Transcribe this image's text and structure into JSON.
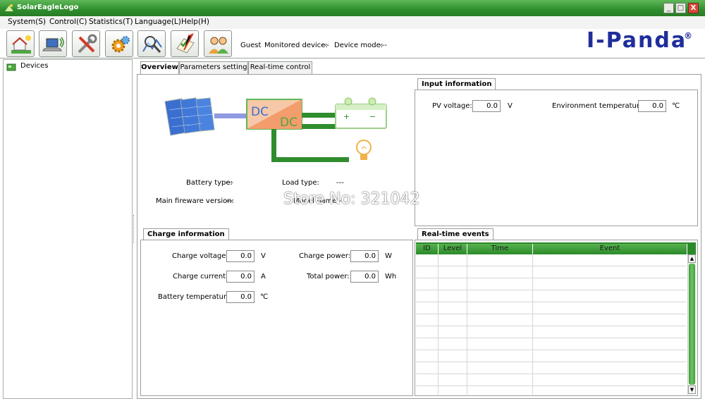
{
  "window": {
    "title": "SolarEagleLogo",
    "minimize": "_",
    "maximize": "□",
    "close": "X"
  },
  "menu": [
    {
      "label": "System(S)"
    },
    {
      "label": "Control(C)"
    },
    {
      "label": "Statistics(T)"
    },
    {
      "label": "Language(L)"
    },
    {
      "label": "Help(H)"
    }
  ],
  "toolbar": {
    "buttons": [
      {
        "icon": "house-solar-icon"
      },
      {
        "icon": "laptop-connection-icon"
      },
      {
        "icon": "tools-icon"
      },
      {
        "icon": "gear-settings-icon"
      },
      {
        "icon": "search-icon"
      },
      {
        "icon": "checklist-edit-icon"
      },
      {
        "icon": "users-icon"
      }
    ],
    "user": "Guest",
    "monitored_device_label": "Monitored device:",
    "monitored_device_value": "---",
    "device_mode_label": "Device mode:",
    "device_mode_value": "---",
    "brand": "I-Panda",
    "brand_mark": "®"
  },
  "tree": {
    "root": "Devices"
  },
  "tabs": [
    {
      "label": "Overview",
      "active": true
    },
    {
      "label": "Parameters setting",
      "active": false
    },
    {
      "label": "Real-time control",
      "active": false
    }
  ],
  "overview": {
    "diagram": {
      "dc_in": "DC",
      "dc_out": "DC",
      "plus": "+",
      "minus": "−"
    },
    "battery_type_label": "Battery type:",
    "battery_type_value": "---",
    "load_type_label": "Load type:",
    "load_type_value": "---",
    "firmware_label": "Main fireware version:",
    "firmware_value": "---",
    "model_label": "Model name",
    "model_value": "---"
  },
  "input_information": {
    "title": "Input information",
    "pv_voltage_label": "PV voltage:",
    "pv_voltage_value": "0.0",
    "pv_voltage_unit": "V",
    "env_temp_label": "Environment temperature:",
    "env_temp_value": "0.0",
    "env_temp_unit": "℃"
  },
  "charge_information": {
    "title": "Charge information",
    "charge_voltage_label": "Charge voltage:",
    "charge_voltage_value": "0.0",
    "charge_voltage_unit": "V",
    "charge_current_label": "Charge current:",
    "charge_current_value": "0.0",
    "charge_current_unit": "A",
    "battery_temp_label": "Battery temperature:",
    "battery_temp_value": "0.0",
    "battery_temp_unit": "℃",
    "charge_power_label": "Charge power:",
    "charge_power_value": "0.0",
    "charge_power_unit": "W",
    "total_power_label": "Total power:",
    "total_power_value": "0.0",
    "total_power_unit": "Wh"
  },
  "realtime_events": {
    "title": "Real-time events",
    "columns": [
      "ID",
      "Level",
      "Time",
      "Event"
    ],
    "rows": []
  },
  "watermark": "Store No: 321042",
  "colors": {
    "title_green": "#2f8d2d",
    "brand_blue": "#1f2e9b",
    "header_green": "#3f9e3a"
  }
}
